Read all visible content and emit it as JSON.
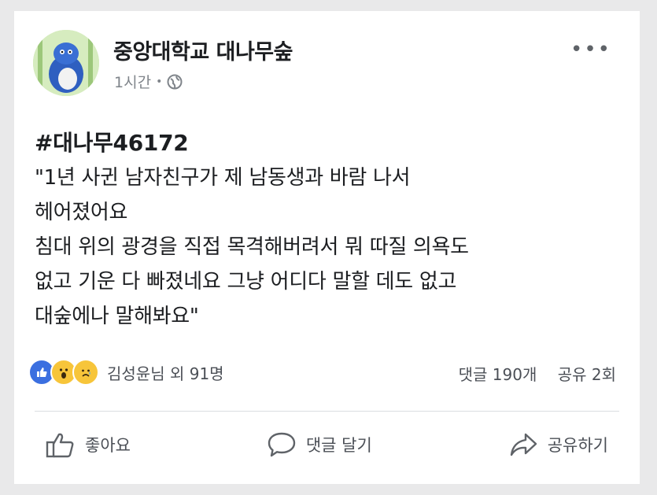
{
  "post": {
    "page_name": "중앙대학교 대나무숲",
    "time": "1시간",
    "meta_separator": "•",
    "more_icon": "more-horizontal-icon",
    "privacy_icon": "globe-icon",
    "hashtag": "#대나무46172",
    "lines": [
      "\"1년 사귄 남자친구가 제 남동생과 바람 나서",
      "헤어졌어요",
      "침대 위의 광경을 직접 목격해버려서 뭐 따질 의욕도",
      "없고 기운 다 빠졌네요 그냥 어디다 말할 데도 없고",
      "대숲에나 말해봐요\""
    ]
  },
  "reactions": {
    "icons": [
      "like-icon",
      "wow-icon",
      "sad-icon"
    ],
    "text": "김성윤님 외 91명",
    "comments": "댓글 190개",
    "shares": "공유 2회"
  },
  "actions": {
    "like": "좋아요",
    "comment": "댓글 달기",
    "share": "공유하기"
  },
  "colors": {
    "like_blue": "#3b6fe0",
    "emoji_yellow": "#f7c53a",
    "meta_gray": "#7f848a"
  }
}
